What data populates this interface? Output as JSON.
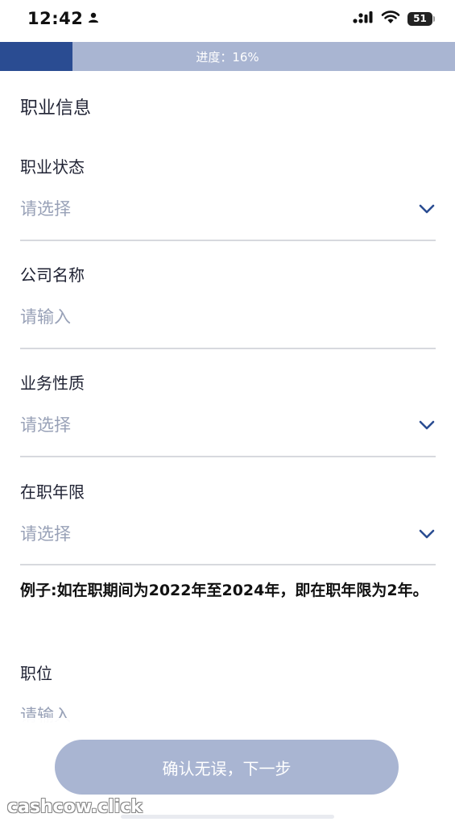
{
  "status_bar": {
    "time": "12:42",
    "battery": "51",
    "icons": [
      "person-icon",
      "cellular-signal-icon",
      "wifi-icon",
      "battery-icon"
    ]
  },
  "progress": {
    "label": "进度：16%",
    "value": 0.16,
    "fill_color": "#2a4c92",
    "track_color": "#a9b5d2"
  },
  "form": {
    "section_title": "职业信息",
    "fields": [
      {
        "label": "职业状态",
        "placeholder": "请选择",
        "type": "select"
      },
      {
        "label": "公司名称",
        "placeholder": "请输入",
        "type": "input"
      },
      {
        "label": "业务性质",
        "placeholder": "请选择",
        "type": "select"
      },
      {
        "label": "在职年限",
        "placeholder": "请选择",
        "type": "select"
      },
      {
        "label": "职位",
        "placeholder": "请输入",
        "type": "input"
      }
    ],
    "note": "例子:如在职期间为2022年至2024年，即在职年限为2年。"
  },
  "footer": {
    "next_button": "确认无误，下一步"
  },
  "watermark": "cashcow.click",
  "colors": {
    "accent": "#2a4c92",
    "button_disabled": "#a9b5d2",
    "placeholder": "#98a1b7"
  }
}
